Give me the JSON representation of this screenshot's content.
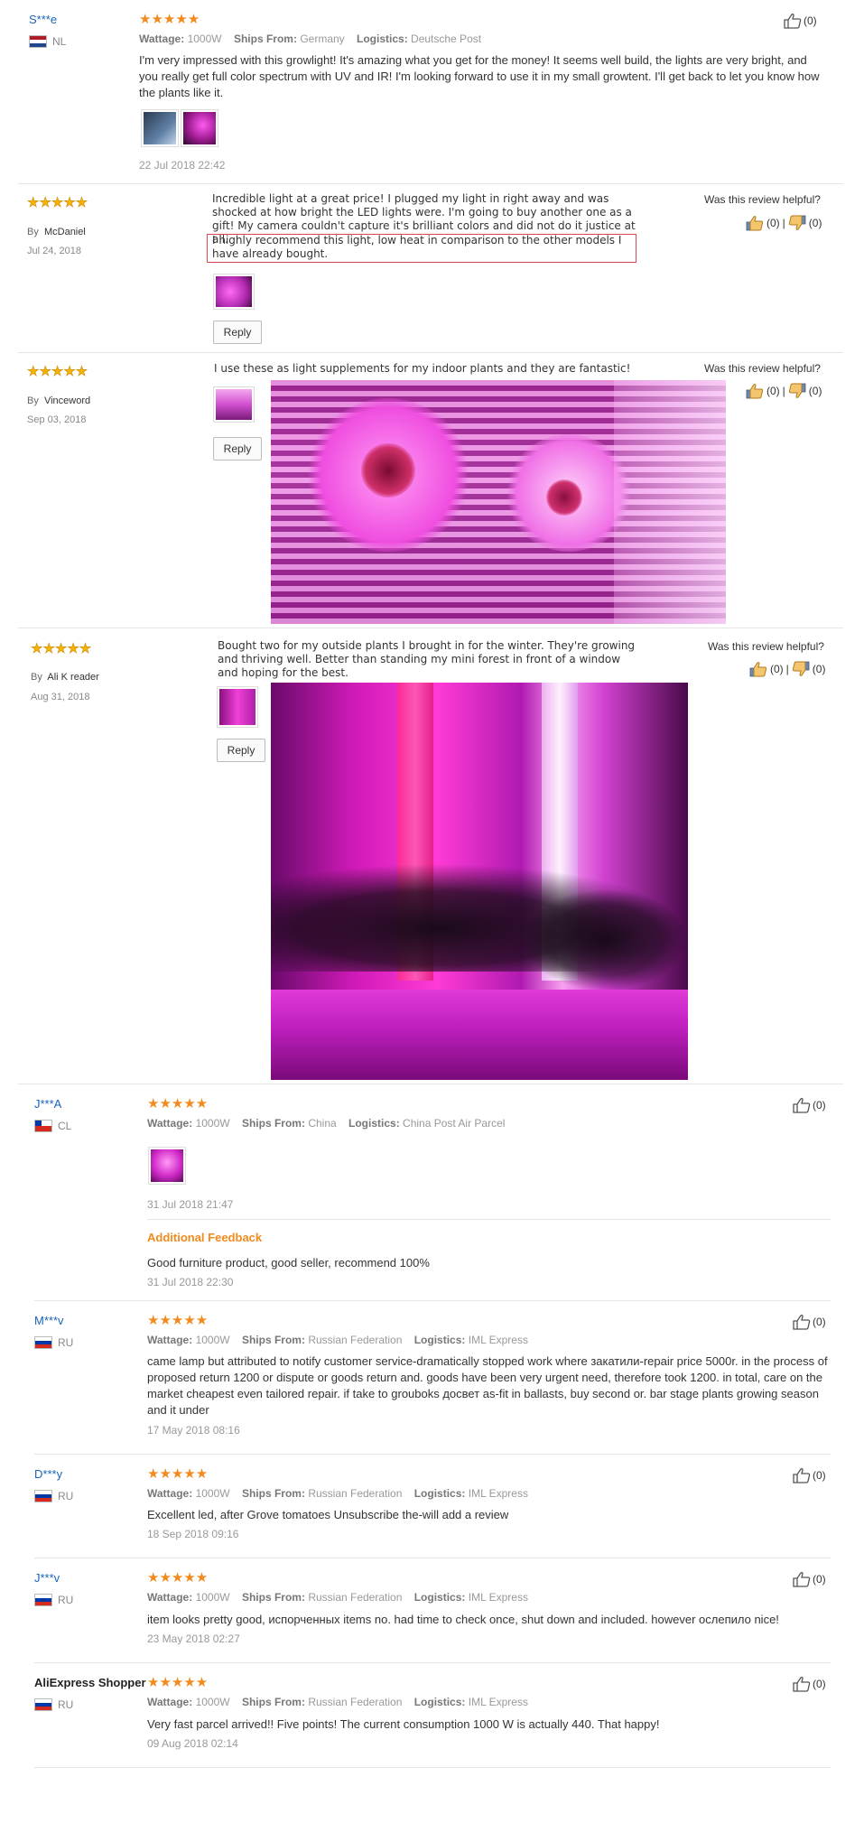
{
  "reviews_ae": [
    {
      "name": "S***e",
      "country": "NL",
      "flag": "nl",
      "wattage_label": "Wattage:",
      "wattage": "1000W",
      "ships_label": "Ships From:",
      "ships": "Germany",
      "logistics_label": "Logistics:",
      "logistics": "Deutsche Post",
      "text": "I'm very impressed with this growlight! It's amazing what you get for the money! It seems well build, the lights are very bright, and you really get full color spectrum with UV and IR! I'm looking forward to use it in my small growtent. I'll get back to let you know how the plants like it.",
      "date": "22 Jul 2018 22:42",
      "likes": "(0)"
    }
  ],
  "reviews_other": [
    {
      "by_label": "By",
      "name": "McDaniel",
      "date": "Jul 24, 2018",
      "text_a": "Incredible light at a great price! I plugged my light in right away and was shocked at how bright the LED lights were. I'm going to buy another one as a gift! My camera couldn't capture it's brilliant colors and did not do it justice at all.",
      "text_b": "I highly recommend this light, low heat in comparison to the other models I have already bought.",
      "helpful": "Was this review helpful?",
      "up": "(0)",
      "sep": "|",
      "down": "(0)",
      "reply": "Reply"
    },
    {
      "by_label": "By",
      "name": "Vinceword",
      "date": "Sep 03, 2018",
      "text": "I use these as light supplements for my indoor plants and they are fantastic!",
      "helpful": "Was this review helpful?",
      "up": "(0)",
      "sep": "|",
      "down": "(0)",
      "reply": "Reply"
    },
    {
      "by_label": "By",
      "name": "Ali K reader",
      "date": "Aug 31, 2018",
      "text": "Bought two for my outside plants I brought in for the winter. They're growing and thriving well. Better than standing my mini forest in front of a window and hoping for the best.",
      "helpful": "Was this review helpful?",
      "up": "(0)",
      "sep": "|",
      "down": "(0)",
      "reply": "Reply"
    }
  ],
  "reviews_ae2": [
    {
      "name": "J***A",
      "country": "CL",
      "flag": "cl",
      "wattage_label": "Wattage:",
      "wattage": "1000W",
      "ships_label": "Ships From:",
      "ships": "China",
      "logistics_label": "Logistics:",
      "logistics": "China Post Air Parcel",
      "date": "31 Jul 2018 21:47",
      "additional_title": "Additional Feedback",
      "additional_text": "Good furniture product, good seller, recommend 100%",
      "additional_date": "31 Jul 2018 22:30",
      "likes": "(0)"
    },
    {
      "name": "M***v",
      "country": "RU",
      "flag": "ru",
      "wattage_label": "Wattage:",
      "wattage": "1000W",
      "ships_label": "Ships From:",
      "ships": "Russian Federation",
      "logistics_label": "Logistics:",
      "logistics": "IML Express",
      "text": "came lamp but attributed to notify customer service-dramatically stopped work where закатили-repair price 5000r. in the process of proposed return 1200 or dispute or goods return and. goods have been very urgent need, therefore took 1200. in total, care on the market cheapest even tailored repair. if take to grouboks досвет as-fit in ballasts, buy second or. bar stage plants growing season and it under",
      "date": "17 May 2018 08:16",
      "likes": "(0)"
    },
    {
      "name": "D***y",
      "country": "RU",
      "flag": "ru",
      "wattage_label": "Wattage:",
      "wattage": "1000W",
      "ships_label": "Ships From:",
      "ships": "Russian Federation",
      "logistics_label": "Logistics:",
      "logistics": "IML Express",
      "text": "Excellent led, after Grove tomatoes Unsubscribe the-will add a review",
      "date": "18 Sep 2018 09:16",
      "likes": "(0)"
    },
    {
      "name": "J***v",
      "country": "RU",
      "flag": "ru",
      "wattage_label": "Wattage:",
      "wattage": "1000W",
      "ships_label": "Ships From:",
      "ships": "Russian Federation",
      "logistics_label": "Logistics:",
      "logistics": "IML Express",
      "text": "item looks pretty good, испорченных items no. had time to check once, shut down and included. however ослепило nice!",
      "date": "23 May 2018 02:27",
      "likes": "(0)"
    },
    {
      "name": "AliExpress Shopper",
      "country": "RU",
      "flag": "ru",
      "wattage_label": "Wattage:",
      "wattage": "1000W",
      "ships_label": "Ships From:",
      "ships": "Russian Federation",
      "logistics_label": "Logistics:",
      "logistics": "IML Express",
      "text": "Very fast parcel arrived!! Five points! The current consumption 1000 W is actually 440. That happy!",
      "date": "09 Aug 2018 02:14",
      "likes": "(0)"
    }
  ],
  "stars": "★★★★★",
  "icons": {
    "like": "thumbs-up-icon",
    "dislike": "thumbs-down-icon"
  },
  "colors": {
    "accent": "#f28a1d",
    "name_blue": "#1a64b6",
    "highlight_box": "#d9484f",
    "photo_magenta": "#e020c8"
  }
}
